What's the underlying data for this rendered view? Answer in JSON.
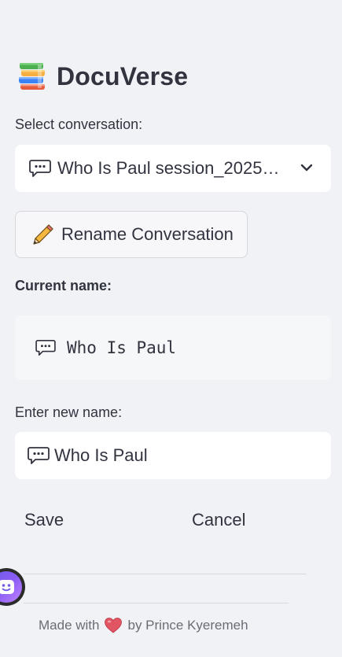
{
  "app": {
    "title": "DocuVerse",
    "logo_icon": "books-stack-icon"
  },
  "select_conversation": {
    "label": "Select conversation:",
    "selected_value": "Who Is Paul session_2025…",
    "icon": "speech-bubble-icon",
    "dropdown_icon": "chevron-down-icon"
  },
  "rename_button": {
    "label": "Rename Conversation",
    "icon": "pencil-icon"
  },
  "current_name": {
    "label": "Current name:",
    "value": "Who Is Paul",
    "icon": "speech-bubble-icon"
  },
  "new_name": {
    "label": "Enter new name:",
    "value": "Who Is Paul",
    "icon": "speech-bubble-icon"
  },
  "actions": {
    "save_label": "Save",
    "cancel_label": "Cancel"
  },
  "footer": {
    "prefix": "Made with",
    "suffix": "by Prince Kyeremeh",
    "heart_icon": "heart-icon"
  },
  "colors": {
    "background": "#f0f2f6",
    "text": "#31333f",
    "heart": "#e25563",
    "avatar_gradient_start": "#6c5ce7",
    "avatar_gradient_end": "#c084fc"
  }
}
